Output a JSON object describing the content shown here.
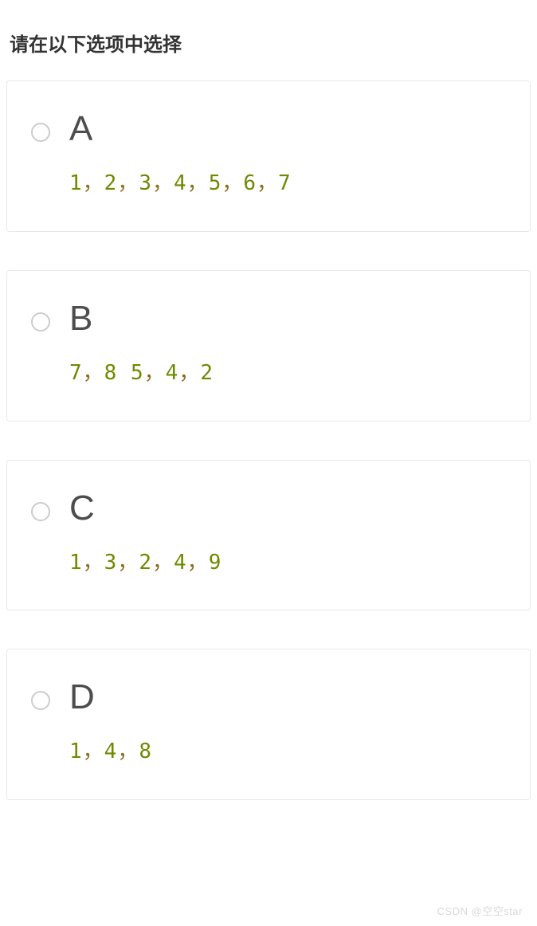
{
  "title": "请在以下选项中选择",
  "options": [
    {
      "label": "A",
      "tokens": [
        {
          "t": "num",
          "v": "1"
        },
        {
          "t": "sep",
          "v": "，"
        },
        {
          "t": "num",
          "v": "2"
        },
        {
          "t": "sep",
          "v": "，"
        },
        {
          "t": "num",
          "v": "3"
        },
        {
          "t": "sep",
          "v": "，"
        },
        {
          "t": "num",
          "v": "4"
        },
        {
          "t": "sep",
          "v": "，"
        },
        {
          "t": "num",
          "v": "5"
        },
        {
          "t": "sep",
          "v": "，"
        },
        {
          "t": "num",
          "v": "6"
        },
        {
          "t": "sep",
          "v": "，"
        },
        {
          "t": "num",
          "v": "7"
        }
      ]
    },
    {
      "label": "B",
      "tokens": [
        {
          "t": "num",
          "v": "7"
        },
        {
          "t": "sep",
          "v": "，"
        },
        {
          "t": "num",
          "v": "8"
        },
        {
          "t": "sep",
          "v": " "
        },
        {
          "t": "num",
          "v": "5"
        },
        {
          "t": "sep",
          "v": "，"
        },
        {
          "t": "num",
          "v": "4"
        },
        {
          "t": "sep",
          "v": "，"
        },
        {
          "t": "num",
          "v": "2"
        }
      ]
    },
    {
      "label": "C",
      "tokens": [
        {
          "t": "num",
          "v": "1"
        },
        {
          "t": "sep",
          "v": "，"
        },
        {
          "t": "num",
          "v": "3"
        },
        {
          "t": "sep",
          "v": "，"
        },
        {
          "t": "num",
          "v": "2"
        },
        {
          "t": "sep",
          "v": "，"
        },
        {
          "t": "num",
          "v": "4"
        },
        {
          "t": "sep",
          "v": "，"
        },
        {
          "t": "num",
          "v": "9"
        }
      ]
    },
    {
      "label": "D",
      "tokens": [
        {
          "t": "num",
          "v": "1"
        },
        {
          "t": "sep",
          "v": "，"
        },
        {
          "t": "num",
          "v": "4"
        },
        {
          "t": "sep",
          "v": "，"
        },
        {
          "t": "num",
          "v": "8"
        }
      ]
    }
  ],
  "watermark": "CSDN @空空star"
}
